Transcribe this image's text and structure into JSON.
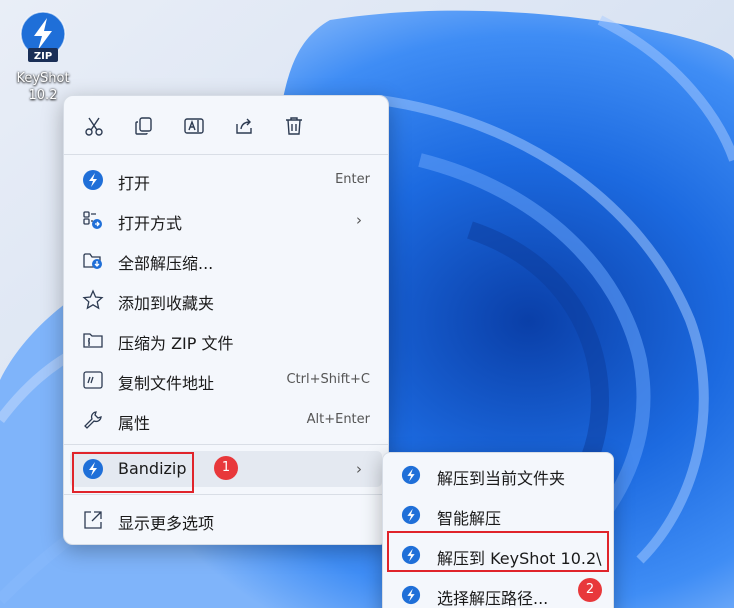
{
  "desktop_icon": {
    "label_line1": "KeyShot",
    "label_line2": "10.2",
    "icon_text": "ZIP"
  },
  "toolbar": {
    "buttons": [
      {
        "name": "cut",
        "icon": "scissors-icon"
      },
      {
        "name": "copy",
        "icon": "copy-icon"
      },
      {
        "name": "rename",
        "icon": "rename-icon"
      },
      {
        "name": "share",
        "icon": "share-icon"
      },
      {
        "name": "delete",
        "icon": "trash-icon"
      }
    ]
  },
  "menu": {
    "items": [
      {
        "label": "打开",
        "shortcut": "Enter",
        "icon": "bandizip-icon"
      },
      {
        "label": "打开方式",
        "shortcut": "",
        "icon": "open-with-icon",
        "submenu": true
      },
      {
        "label": "全部解压缩...",
        "shortcut": "",
        "icon": "folder-extract-icon"
      },
      {
        "label": "添加到收藏夹",
        "shortcut": "",
        "icon": "star-icon"
      },
      {
        "label": "压缩为 ZIP 文件",
        "shortcut": "",
        "icon": "zip-folder-icon"
      },
      {
        "label": "复制文件地址",
        "shortcut": "Ctrl+Shift+C",
        "icon": "copy-path-icon"
      },
      {
        "label": "属性",
        "shortcut": "Alt+Enter",
        "icon": "wrench-icon"
      }
    ],
    "bandizip": {
      "label": "Bandizip",
      "icon": "bandizip-icon",
      "badge": "1"
    },
    "more_options": {
      "label": "显示更多选项",
      "icon": "more-options-icon"
    }
  },
  "submenu": {
    "items": [
      {
        "label": "解压到当前文件夹",
        "icon": "bandizip-icon"
      },
      {
        "label": "智能解压",
        "icon": "bandizip-icon"
      },
      {
        "label": "解压到 KeyShot 10.2\\",
        "icon": "bandizip-icon"
      },
      {
        "label": "选择解压路径...",
        "icon": "bandizip-icon"
      }
    ],
    "badge": "2"
  },
  "colors": {
    "accent": "#1f6fd8",
    "highlight_box": "#e0242b",
    "badge": "#e8383b"
  }
}
